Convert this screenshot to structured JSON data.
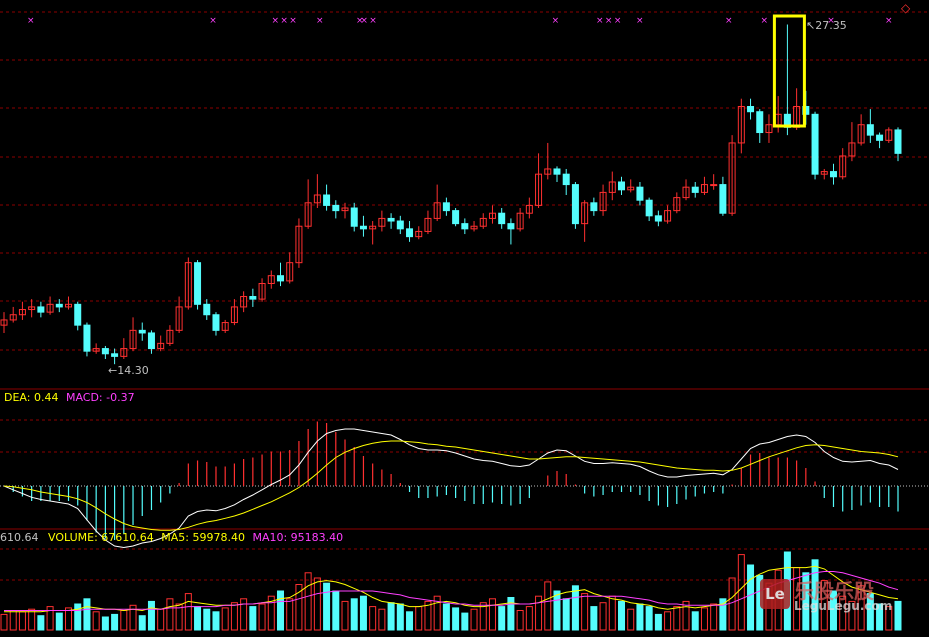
{
  "colors": {
    "background": "#000000",
    "up": "#ff3030",
    "down": "#54fcfc",
    "grid": "#8b0000",
    "marker": "#ff40ff",
    "dif": "#ffffff",
    "dea": "#ffff00",
    "macd": "#ff40ff",
    "ma5": "#ffff00",
    "ma10": "#ff40ff",
    "highlight": "#ffff00",
    "text": "#c0c0c0"
  },
  "price_panel": {
    "high_label": "27.35",
    "low_label": "14.30",
    "corner_icon": "diamond-icon"
  },
  "macd_panel": {
    "dea_label": "DEA: 0.44",
    "macd_label": "MACD: -0.37"
  },
  "volume_panel": {
    "prefix_label": "610.64",
    "volume_label": "VOLUME: 67610.64",
    "ma5_label": "MA5: 59978.40",
    "ma10_label": "MA10: 95183.40"
  },
  "watermark": {
    "badge": "Le",
    "title": "乐股乐股",
    "url": "LeguLegu.com"
  },
  "chart_data": {
    "type": "candlestick",
    "price_high": 27.35,
    "price_low": 14.3,
    "candles": [
      [
        15.8,
        16.0,
        15.5,
        16.3
      ],
      [
        16.0,
        16.2,
        15.9,
        16.5
      ],
      [
        16.2,
        16.4,
        16.0,
        16.7
      ],
      [
        16.4,
        16.5,
        16.1,
        16.8
      ],
      [
        16.5,
        16.3,
        16.1,
        16.7
      ],
      [
        16.3,
        16.6,
        16.2,
        16.9
      ],
      [
        16.6,
        16.5,
        16.3,
        16.8
      ],
      [
        16.5,
        16.6,
        16.4,
        16.9
      ],
      [
        16.6,
        15.8,
        15.6,
        16.7
      ],
      [
        15.8,
        14.8,
        14.6,
        15.9
      ],
      [
        14.8,
        14.9,
        14.7,
        15.1
      ],
      [
        14.9,
        14.7,
        14.5,
        15.0
      ],
      [
        14.7,
        14.6,
        14.3,
        14.9
      ],
      [
        14.6,
        14.9,
        14.5,
        15.3
      ],
      [
        14.9,
        15.6,
        14.8,
        16.1
      ],
      [
        15.6,
        15.5,
        15.2,
        15.9
      ],
      [
        15.5,
        14.9,
        14.7,
        15.6
      ],
      [
        14.9,
        15.1,
        14.8,
        15.4
      ],
      [
        15.1,
        15.6,
        15.0,
        15.8
      ],
      [
        15.6,
        16.5,
        15.5,
        16.9
      ],
      [
        16.5,
        18.2,
        16.4,
        18.4
      ],
      [
        18.2,
        16.6,
        16.4,
        18.3
      ],
      [
        16.6,
        16.2,
        16.0,
        16.8
      ],
      [
        16.2,
        15.6,
        15.4,
        16.3
      ],
      [
        15.6,
        15.9,
        15.5,
        16.0
      ],
      [
        15.9,
        16.5,
        15.8,
        16.8
      ],
      [
        16.5,
        16.9,
        16.3,
        17.1
      ],
      [
        16.9,
        16.8,
        16.5,
        17.2
      ],
      [
        16.8,
        17.4,
        16.7,
        17.6
      ],
      [
        17.4,
        17.7,
        17.2,
        17.9
      ],
      [
        17.7,
        17.5,
        17.3,
        18.2
      ],
      [
        17.5,
        18.2,
        17.4,
        18.6
      ],
      [
        18.2,
        19.6,
        18.0,
        19.9
      ],
      [
        19.6,
        20.5,
        19.5,
        21.4
      ],
      [
        20.5,
        20.8,
        20.3,
        21.6
      ],
      [
        20.8,
        20.4,
        20.2,
        21.2
      ],
      [
        20.4,
        20.2,
        19.9,
        20.6
      ],
      [
        20.2,
        20.3,
        19.9,
        20.5
      ],
      [
        20.3,
        19.6,
        19.4,
        20.5
      ],
      [
        19.6,
        19.5,
        19.2,
        20.0
      ],
      [
        19.5,
        19.6,
        18.9,
        19.8
      ],
      [
        19.6,
        19.9,
        19.4,
        20.2
      ],
      [
        19.9,
        19.8,
        19.5,
        20.1
      ],
      [
        19.8,
        19.5,
        19.3,
        20.0
      ],
      [
        19.5,
        19.2,
        19.0,
        19.8
      ],
      [
        19.2,
        19.4,
        19.1,
        19.6
      ],
      [
        19.4,
        19.9,
        19.3,
        20.2
      ],
      [
        19.9,
        20.5,
        19.8,
        21.2
      ],
      [
        20.5,
        20.2,
        20.0,
        20.7
      ],
      [
        20.2,
        19.7,
        19.6,
        20.3
      ],
      [
        19.7,
        19.5,
        19.3,
        19.9
      ],
      [
        19.5,
        19.6,
        19.4,
        19.8
      ],
      [
        19.6,
        19.9,
        19.5,
        20.1
      ],
      [
        19.9,
        20.1,
        19.7,
        20.4
      ],
      [
        20.1,
        19.7,
        19.5,
        20.3
      ],
      [
        19.7,
        19.5,
        18.9,
        19.9
      ],
      [
        19.5,
        20.1,
        19.4,
        20.3
      ],
      [
        20.1,
        20.4,
        19.9,
        20.7
      ],
      [
        20.4,
        21.6,
        20.3,
        22.4
      ],
      [
        21.6,
        21.8,
        21.4,
        22.8
      ],
      [
        21.8,
        21.6,
        21.3,
        21.9
      ],
      [
        21.6,
        21.2,
        20.8,
        21.8
      ],
      [
        21.2,
        19.7,
        19.5,
        21.3
      ],
      [
        19.7,
        20.5,
        19.0,
        20.6
      ],
      [
        20.5,
        20.2,
        20.0,
        20.7
      ],
      [
        20.2,
        20.9,
        20.0,
        21.2
      ],
      [
        20.9,
        21.3,
        20.6,
        21.7
      ],
      [
        21.3,
        21.0,
        20.8,
        21.5
      ],
      [
        21.0,
        21.1,
        20.9,
        21.4
      ],
      [
        21.1,
        20.6,
        20.4,
        21.3
      ],
      [
        20.6,
        20.0,
        19.8,
        20.7
      ],
      [
        20.0,
        19.8,
        19.6,
        20.2
      ],
      [
        19.8,
        20.2,
        19.7,
        20.4
      ],
      [
        20.2,
        20.7,
        20.1,
        20.9
      ],
      [
        20.7,
        21.1,
        20.6,
        21.4
      ],
      [
        21.1,
        20.9,
        20.7,
        21.3
      ],
      [
        20.9,
        21.2,
        20.8,
        21.5
      ],
      [
        21.2,
        21.2,
        21.0,
        21.6
      ],
      [
        21.2,
        20.1,
        20.0,
        21.5
      ],
      [
        20.1,
        22.8,
        20.0,
        23.1
      ],
      [
        22.8,
        24.2,
        22.4,
        24.5
      ],
      [
        24.2,
        24.0,
        23.7,
        24.5
      ],
      [
        24.0,
        23.2,
        22.8,
        24.1
      ],
      [
        23.2,
        23.5,
        22.8,
        23.9
      ],
      [
        23.5,
        23.9,
        23.2,
        24.6
      ],
      [
        23.9,
        23.4,
        23.1,
        27.35
      ],
      [
        23.4,
        24.2,
        23.3,
        24.9
      ],
      [
        24.2,
        23.9,
        23.5,
        24.8
      ],
      [
        23.9,
        21.6,
        21.4,
        24.0
      ],
      [
        21.6,
        21.7,
        21.4,
        21.8
      ],
      [
        21.7,
        21.5,
        21.2,
        22.0
      ],
      [
        21.5,
        22.3,
        21.4,
        22.6
      ],
      [
        22.3,
        22.8,
        22.1,
        23.6
      ],
      [
        22.8,
        23.5,
        22.7,
        23.9
      ],
      [
        23.5,
        23.1,
        22.8,
        24.1
      ],
      [
        23.1,
        22.9,
        22.6,
        23.2
      ],
      [
        22.9,
        23.3,
        22.8,
        23.4
      ],
      [
        23.3,
        22.4,
        22.1,
        23.4
      ]
    ],
    "markers_count": 18,
    "macd": {
      "dif": [
        0.0,
        -0.05,
        -0.1,
        -0.15,
        -0.18,
        -0.2,
        -0.22,
        -0.24,
        -0.3,
        -0.45,
        -0.6,
        -0.72,
        -0.8,
        -0.82,
        -0.8,
        -0.76,
        -0.74,
        -0.7,
        -0.64,
        -0.56,
        -0.4,
        -0.34,
        -0.32,
        -0.33,
        -0.3,
        -0.25,
        -0.18,
        -0.12,
        -0.05,
        0.02,
        0.08,
        0.15,
        0.28,
        0.45,
        0.6,
        0.7,
        0.74,
        0.76,
        0.76,
        0.74,
        0.72,
        0.7,
        0.68,
        0.62,
        0.55,
        0.5,
        0.48,
        0.48,
        0.47,
        0.44,
        0.4,
        0.36,
        0.34,
        0.33,
        0.3,
        0.27,
        0.26,
        0.28,
        0.36,
        0.44,
        0.48,
        0.47,
        0.4,
        0.33,
        0.3,
        0.3,
        0.31,
        0.3,
        0.29,
        0.26,
        0.2,
        0.15,
        0.12,
        0.12,
        0.14,
        0.15,
        0.16,
        0.17,
        0.15,
        0.22,
        0.36,
        0.5,
        0.56,
        0.58,
        0.62,
        0.66,
        0.68,
        0.66,
        0.58,
        0.46,
        0.38,
        0.33,
        0.32,
        0.33,
        0.34,
        0.3,
        0.28,
        0.22
      ],
      "dea": [
        0.0,
        -0.01,
        -0.03,
        -0.05,
        -0.08,
        -0.1,
        -0.12,
        -0.14,
        -0.17,
        -0.22,
        -0.29,
        -0.37,
        -0.44,
        -0.5,
        -0.54,
        -0.56,
        -0.58,
        -0.59,
        -0.59,
        -0.58,
        -0.55,
        -0.51,
        -0.48,
        -0.46,
        -0.43,
        -0.4,
        -0.36,
        -0.31,
        -0.26,
        -0.21,
        -0.15,
        -0.09,
        -0.02,
        0.07,
        0.17,
        0.28,
        0.38,
        0.45,
        0.5,
        0.54,
        0.57,
        0.59,
        0.6,
        0.6,
        0.59,
        0.58,
        0.56,
        0.55,
        0.53,
        0.52,
        0.5,
        0.48,
        0.46,
        0.44,
        0.42,
        0.4,
        0.38,
        0.36,
        0.36,
        0.37,
        0.38,
        0.39,
        0.39,
        0.38,
        0.37,
        0.36,
        0.35,
        0.34,
        0.33,
        0.32,
        0.3,
        0.28,
        0.26,
        0.24,
        0.23,
        0.22,
        0.21,
        0.21,
        0.2,
        0.21,
        0.24,
        0.29,
        0.34,
        0.39,
        0.43,
        0.47,
        0.51,
        0.54,
        0.55,
        0.54,
        0.52,
        0.5,
        0.48,
        0.46,
        0.45,
        0.44,
        0.42,
        0.39
      ]
    },
    "volume": [
      12,
      15,
      14,
      16,
      11,
      18,
      13,
      17,
      20,
      24,
      14,
      10,
      12,
      15,
      19,
      11,
      22,
      16,
      24,
      20,
      28,
      18,
      16,
      14,
      17,
      21,
      24,
      18,
      20,
      26,
      30,
      24,
      35,
      44,
      40,
      36,
      30,
      22,
      24,
      26,
      18,
      16,
      21,
      20,
      14,
      18,
      22,
      26,
      20,
      17,
      13,
      16,
      21,
      24,
      18,
      25,
      15,
      18,
      26,
      37,
      30,
      24,
      34,
      28,
      18,
      21,
      26,
      22,
      16,
      20,
      18,
      12,
      14,
      18,
      22,
      14,
      17,
      20,
      24,
      40,
      58,
      50,
      42,
      36,
      46,
      60,
      48,
      44,
      54,
      38,
      30,
      26,
      22,
      34,
      28,
      20,
      18,
      22
    ],
    "ma5": [
      14,
      14,
      14,
      14,
      14,
      15,
      15,
      15,
      16,
      18,
      17,
      16,
      16,
      15,
      16,
      15,
      17,
      16,
      18,
      19,
      22,
      21,
      20,
      19,
      19,
      19,
      20,
      20,
      21,
      22,
      24,
      25,
      29,
      34,
      37,
      38,
      37,
      35,
      32,
      29,
      25,
      22,
      21,
      20,
      18,
      18,
      19,
      21,
      22,
      21,
      19,
      18,
      18,
      19,
      20,
      21,
      20,
      20,
      21,
      24,
      27,
      29,
      30,
      31,
      28,
      26,
      24,
      23,
      21,
      20,
      19,
      17,
      16,
      17,
      18,
      17,
      18,
      19,
      20,
      25,
      32,
      39,
      43,
      46,
      47,
      48,
      48,
      48,
      49,
      47,
      42,
      37,
      33,
      31,
      29,
      27,
      25,
      24
    ],
    "ma10": [
      15,
      15,
      15,
      15,
      15,
      15,
      15,
      15,
      15,
      16,
      16,
      16,
      16,
      16,
      16,
      16,
      16,
      16,
      17,
      17,
      18,
      18,
      18,
      18,
      19,
      19,
      20,
      20,
      21,
      21,
      22,
      22,
      24,
      26,
      28,
      29,
      30,
      30,
      30,
      30,
      30,
      29,
      28,
      27,
      25,
      24,
      23,
      22,
      21,
      20,
      20,
      19,
      19,
      19,
      19,
      20,
      20,
      20,
      21,
      22,
      23,
      24,
      25,
      26,
      26,
      26,
      26,
      26,
      25,
      24,
      23,
      21,
      20,
      20,
      19,
      19,
      19,
      19,
      19,
      21,
      24,
      27,
      30,
      33,
      36,
      38,
      40,
      42,
      44,
      45,
      45,
      44,
      42,
      40,
      38,
      36,
      33,
      31
    ]
  }
}
